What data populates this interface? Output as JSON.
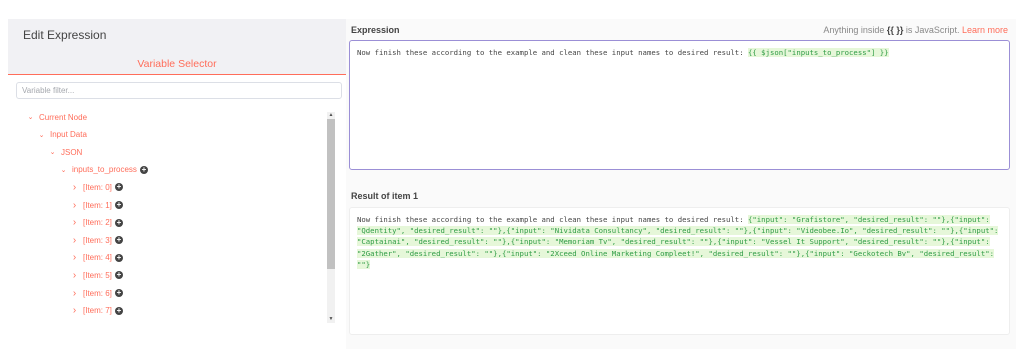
{
  "left": {
    "title": "Edit Expression",
    "selector_title": "Variable Selector",
    "filter_placeholder": "Variable filter..."
  },
  "tree": [
    {
      "label": "Current Node",
      "level": 0,
      "chevron": "down",
      "plus": false
    },
    {
      "label": "Input Data",
      "level": 1,
      "chevron": "down",
      "plus": false
    },
    {
      "label": "JSON",
      "level": 2,
      "chevron": "down",
      "plus": false
    },
    {
      "label": "inputs_to_process",
      "level": 3,
      "chevron": "down",
      "plus": true
    },
    {
      "label": "[Item: 0]",
      "level": 4,
      "chevron": "right",
      "plus": true
    },
    {
      "label": "[Item: 1]",
      "level": 4,
      "chevron": "right",
      "plus": true
    },
    {
      "label": "[Item: 2]",
      "level": 4,
      "chevron": "right",
      "plus": true
    },
    {
      "label": "[Item: 3]",
      "level": 4,
      "chevron": "right",
      "plus": true
    },
    {
      "label": "[Item: 4]",
      "level": 4,
      "chevron": "right",
      "plus": true
    },
    {
      "label": "[Item: 5]",
      "level": 4,
      "chevron": "right",
      "plus": true
    },
    {
      "label": "[Item: 6]",
      "level": 4,
      "chevron": "right",
      "plus": true
    },
    {
      "label": "[Item: 7]",
      "level": 4,
      "chevron": "right",
      "plus": true
    }
  ],
  "expression": {
    "label": "Expression",
    "hint_prefix": "Anything inside",
    "hint_braces": "{{ }}",
    "hint_suffix": "is JavaScript.",
    "learn_more": "Learn more",
    "text": "Now finish these according to the example and clean these input names to desired result: ",
    "highlight": "{{ $json[\"inputs_to_process\"] }}"
  },
  "result": {
    "label": "Result of item 1",
    "text": "Now finish these according to the example and clean these input names to desired result: ",
    "highlight": "{\"input\": \"Grafistore\", \"desired_result\": \"\"},{\"input\": \"Qdentity\", \"desired_result\": \"\"},{\"input\": \"Nividata Consultancy\", \"desired_result\": \"\"},{\"input\": \"Videobee.Io\", \"desired_result\": \"\"},{\"input\": \"Captainai\", \"desired_result\": \"\"},{\"input\": \"Memoriam Tv\", \"desired_result\": \"\"},{\"input\": \"Vessel It Support\", \"desired_result\": \"\"},{\"input\": \"2Gather\", \"desired_result\": \"\"},{\"input\": \"2Xceed Online Marketing Compleet!\", \"desired_result\": \"\"},{\"input\": \"Geckotech Bv\", \"desired_result\": \"\"}"
  },
  "colors": {
    "accent": "#ff6d5a",
    "highlight_bg": "#e6f7d9",
    "highlight_text": "#2f9c45",
    "expression_border": "#9b8fd6"
  },
  "icons": {
    "expand": "chevron-down-icon",
    "collapse": "chevron-right-icon",
    "add": "plus-circle-icon"
  }
}
